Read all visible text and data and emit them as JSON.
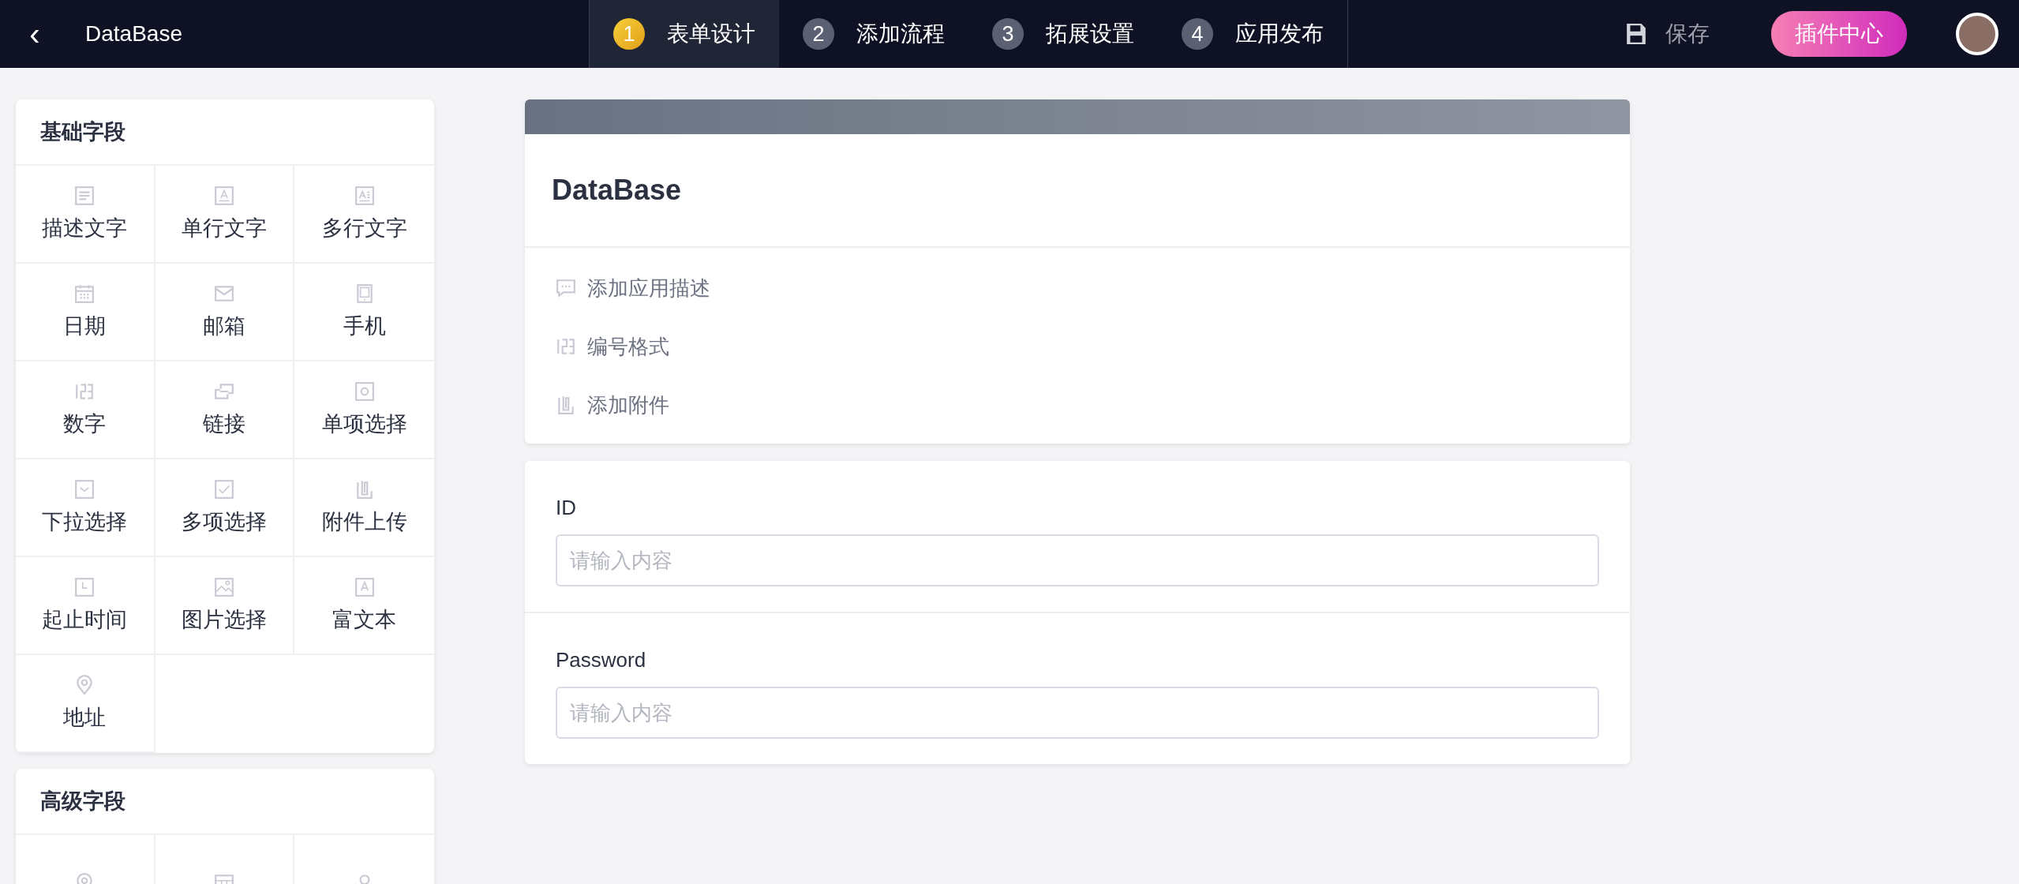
{
  "header": {
    "back": "‹",
    "title": "DataBase",
    "steps": [
      {
        "number": "1",
        "label": "表单设计",
        "selected": true
      },
      {
        "number": "2",
        "label": "添加流程",
        "selected": false
      },
      {
        "number": "3",
        "label": "拓展设置",
        "selected": false
      },
      {
        "number": "4",
        "label": "应用发布",
        "selected": false
      }
    ],
    "save": "保存",
    "plugin_button": "插件中心"
  },
  "sidebar": {
    "groups": [
      {
        "title": "基础字段",
        "items": [
          {
            "kind": "text",
            "label": "描述文字"
          },
          {
            "kind": "single",
            "label": "单行文字"
          },
          {
            "kind": "multi",
            "label": "多行文字"
          },
          {
            "kind": "date",
            "label": "日期"
          },
          {
            "kind": "mail",
            "label": "邮箱"
          },
          {
            "kind": "phone",
            "label": "手机"
          },
          {
            "kind": "number",
            "label": "数字"
          },
          {
            "kind": "link",
            "label": "链接"
          },
          {
            "kind": "radio",
            "label": "单项选择"
          },
          {
            "kind": "dropdown",
            "label": "下拉选择"
          },
          {
            "kind": "checkbox",
            "label": "多项选择"
          },
          {
            "kind": "attach",
            "label": "附件上传"
          },
          {
            "kind": "time",
            "label": "起止时间"
          },
          {
            "kind": "image",
            "label": "图片选择"
          },
          {
            "kind": "richtext",
            "label": "富文本"
          },
          {
            "kind": "location",
            "label": "地址"
          }
        ]
      },
      {
        "title": "高级字段",
        "items": [
          {
            "kind": "location"
          },
          {
            "kind": "table"
          },
          {
            "kind": "person"
          }
        ]
      }
    ]
  },
  "form": {
    "title": "DataBase",
    "actions": [
      {
        "kind": "comment",
        "label": "添加应用描述"
      },
      {
        "kind": "number",
        "label": "编号格式"
      },
      {
        "kind": "attach",
        "label": "添加附件"
      }
    ],
    "fields": [
      {
        "label": "ID",
        "placeholder": "请输入内容"
      },
      {
        "label": "Password",
        "placeholder": "请输入内容"
      }
    ]
  }
}
